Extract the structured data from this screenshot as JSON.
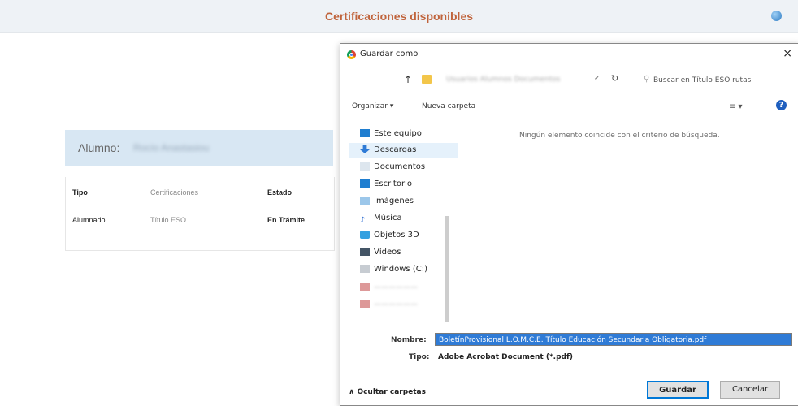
{
  "page": {
    "title": "Certificaciones disponibles",
    "student_label": "Alumno:",
    "student_name_obscured": "Rocío Anastasiou",
    "table": {
      "headers": [
        "Tipo",
        "Certificaciones",
        "Estado"
      ],
      "rows": [
        [
          "Alumnado",
          "Título ESO",
          "En Trámite"
        ]
      ]
    }
  },
  "dialog": {
    "title": "Guardar como",
    "close_label": "×",
    "address_obscured": "Usuarios  Alumnos  Documentos",
    "search_placeholder": "Buscar en Título ESO rutas",
    "organize_label": "Organizar ▾",
    "new_folder_label": "Nueva carpeta",
    "empty_message": "Ningún elemento coincide con el criterio de búsqueda.",
    "nav_items": [
      "Este equipo",
      "Descargas",
      "Documentos",
      "Escritorio",
      "Imágenes",
      "Música",
      "Objetos 3D",
      "Vídeos",
      "Windows (C:)"
    ],
    "filename_label": "Nombre:",
    "filename_value": "BoletínProvisional                    L.O.M.C.E. Título Educación Secundaria Obligatoria.pdf",
    "type_label": "Tipo:",
    "type_value": "Adobe Acrobat Document (*.pdf)",
    "hide_folders_label": "∧ Ocultar carpetas",
    "save_label": "Guardar",
    "cancel_label": "Cancelar"
  }
}
